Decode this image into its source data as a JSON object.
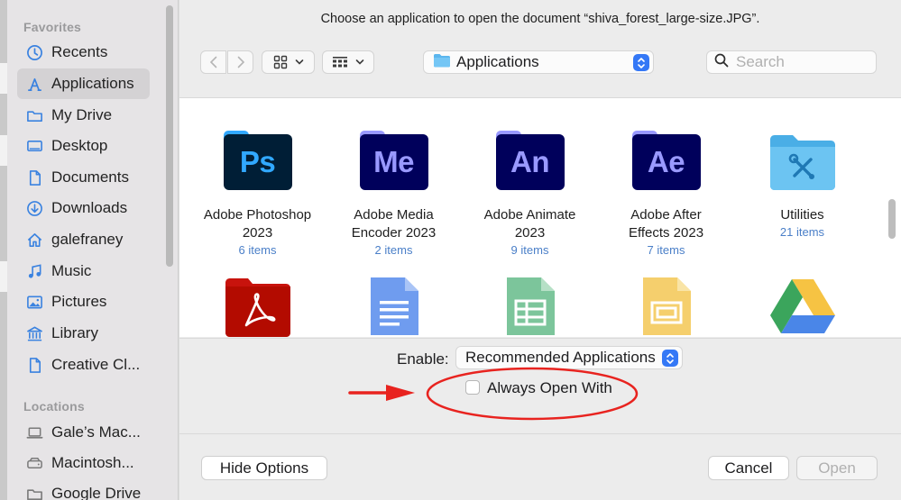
{
  "sidebar": {
    "favorites_heading": "Favorites",
    "locations_heading": "Locations",
    "favorites": [
      {
        "label": "Recents",
        "icon": "clock-icon"
      },
      {
        "label": "Applications",
        "icon": "applications-icon"
      },
      {
        "label": "My Drive",
        "icon": "folder-icon"
      },
      {
        "label": "Desktop",
        "icon": "desktop-icon"
      },
      {
        "label": "Documents",
        "icon": "document-icon"
      },
      {
        "label": "Downloads",
        "icon": "download-icon"
      },
      {
        "label": "galefraney",
        "icon": "home-icon"
      },
      {
        "label": "Music",
        "icon": "music-icon"
      },
      {
        "label": "Pictures",
        "icon": "pictures-icon"
      },
      {
        "label": "Library",
        "icon": "library-icon"
      },
      {
        "label": "Creative Cl...",
        "icon": "document-icon"
      }
    ],
    "locations": [
      {
        "label": "Gale’s Mac...",
        "icon": "laptop-icon"
      },
      {
        "label": "Macintosh...",
        "icon": "drive-icon"
      },
      {
        "label": "Google Drive",
        "icon": "folder-icon"
      }
    ],
    "selected": "Applications"
  },
  "dialog": {
    "title": "Choose an application to open the document “shiva_forest_large-size.JPG”.",
    "location": "Applications",
    "search_placeholder": "Search",
    "apps_row1": [
      {
        "name1": "Adobe Photoshop",
        "name2": "2023",
        "count": "6 items",
        "abbr": "Ps",
        "bg": "#001e36",
        "fg": "#31a8ff"
      },
      {
        "name1": "Adobe Media",
        "name2": "Encoder 2023",
        "count": "2 items",
        "abbr": "Me",
        "bg": "#00005b",
        "fg": "#9999ff"
      },
      {
        "name1": "Adobe Animate",
        "name2": "2023",
        "count": "9 items",
        "abbr": "An",
        "bg": "#00005b",
        "fg": "#9999ff"
      },
      {
        "name1": "Adobe After",
        "name2": "Effects 2023",
        "count": "7 items",
        "abbr": "Ae",
        "bg": "#00005b",
        "fg": "#9999ff"
      },
      {
        "name1": "Utilities",
        "name2": "",
        "count": "21 items",
        "abbr": "",
        "bg": "#5ab8ea",
        "fg": "#1e6fa8"
      }
    ],
    "enable_label": "Enable:",
    "enable_value": "Recommended Applications",
    "always_open_label": "Always Open With",
    "always_open_checked": false,
    "hide_options_label": "Hide Options",
    "cancel_label": "Cancel",
    "open_label": "Open"
  },
  "colors": {
    "accent": "#3478f6",
    "annotation": "#e8231f",
    "count_text": "#4a7fc8"
  }
}
